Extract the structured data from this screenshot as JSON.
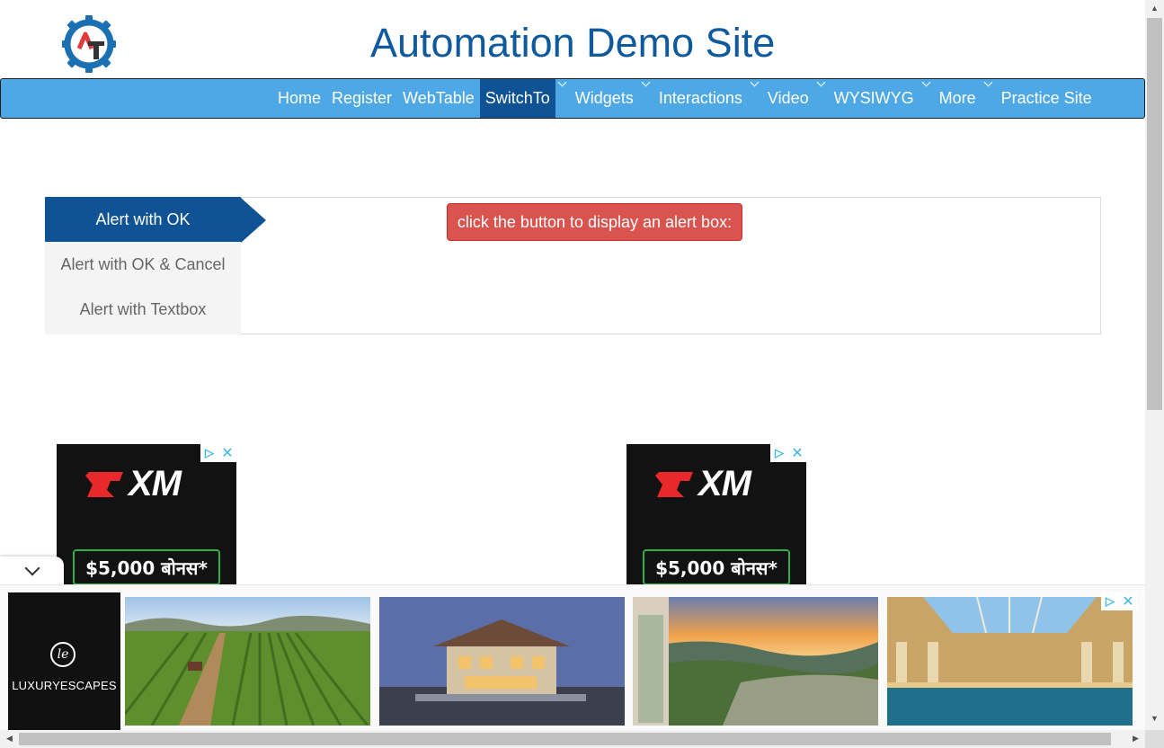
{
  "header": {
    "title": "Automation Demo Site",
    "logo_icon": "gear-logo-icon",
    "logo_letters": "AT"
  },
  "nav": {
    "items": [
      {
        "label": "Home",
        "dropdown": false
      },
      {
        "label": "Register",
        "dropdown": false
      },
      {
        "label": "WebTable",
        "dropdown": false
      },
      {
        "label": "SwitchTo",
        "dropdown": true,
        "active": true
      },
      {
        "label": "Widgets",
        "dropdown": true
      },
      {
        "label": "Interactions",
        "dropdown": true
      },
      {
        "label": "Video",
        "dropdown": true
      },
      {
        "label": "WYSIWYG",
        "dropdown": true
      },
      {
        "label": "More",
        "dropdown": true
      },
      {
        "label": "Practice Site",
        "dropdown": false
      }
    ]
  },
  "alerts": {
    "tabs": [
      {
        "label": "Alert with OK",
        "active": true
      },
      {
        "label": "Alert with OK & Cancel",
        "active": false
      },
      {
        "label": "Alert with Textbox",
        "active": false
      }
    ],
    "button_label": "click the button to display an alert box:"
  },
  "ads": {
    "xm_left": {
      "brand": "XM",
      "bonus": "$5,000 बोनस*"
    },
    "xm_right": {
      "brand": "XM",
      "bonus": "$5,000 बोनस*"
    },
    "bottom": {
      "brand_mark": "le",
      "brand": "LUXURYESCAPES"
    }
  },
  "colors": {
    "title": "#0f5a9c",
    "navbar": "#4ea8e6",
    "nav_active": "#0f5394",
    "alert_button": "#d9534f"
  }
}
